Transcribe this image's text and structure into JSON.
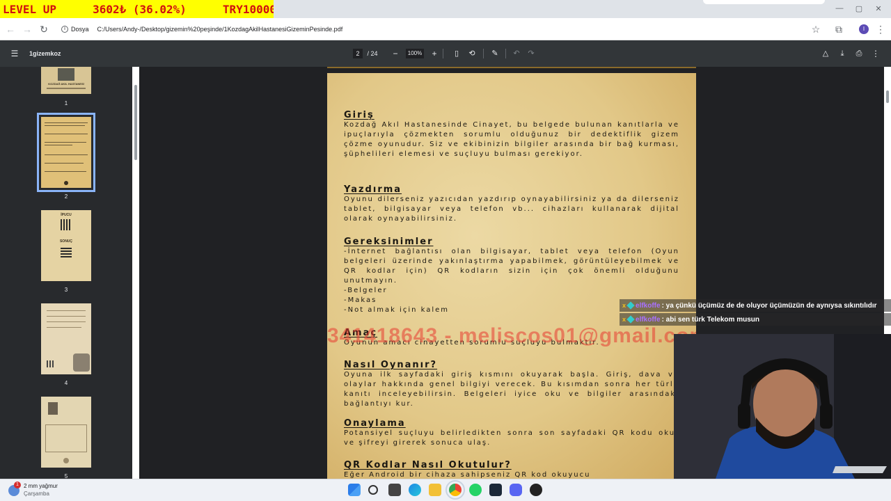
{
  "alert": {
    "level": "LEVEL UP",
    "amount": "3602₺ (36.02%)",
    "target": "TRY10000"
  },
  "browser": {
    "site_label": "Dosya",
    "url": "C:/Users/Andy-/Desktop/gizemin%20peşinde/1KozdagAkilHastanesiGizeminPesinde.pdf"
  },
  "pdf_toolbar": {
    "doc_title": "1gizemkoz",
    "current_page": "2",
    "total_pages": "/ 24",
    "zoom": "100%"
  },
  "sidebar": {
    "pages": [
      {
        "num": "1",
        "label": "KOZDAĞ AKIL HASTANESİ"
      },
      {
        "num": "2"
      },
      {
        "num": "3",
        "top": "İPUCU",
        "bottom": "SONUÇ"
      },
      {
        "num": "4"
      },
      {
        "num": "5"
      }
    ]
  },
  "document": {
    "sections": [
      {
        "heading": "Giriş",
        "body": "Kozdağ Akıl Hastanesinde Cinayet, bu belgede bulunan kanıtlarla ve ipuçlarıyla çözmekten sorumlu olduğunuz bir dedektiflik gizem çözme oyunudur. Siz ve ekibinizin bilgiler arasında bir bağ kurması, şüphelileri elemesi ve suçluyu bulması gerekiyor."
      },
      {
        "heading": "Yazdırma",
        "body": "Oyunu dilerseniz yazıcıdan yazdırıp oynayabilirsiniz ya da dilerseniz tablet, bilgisayar veya telefon vb... cihazları kullanarak dijital olarak oynayabilirsiniz."
      },
      {
        "heading": "Gereksinimler",
        "body": "-İnternet bağlantısı olan bilgisayar, tablet veya telefon (Oyun belgeleri üzerinde yakınlaştırma yapabilmek, görüntüleyebilmek ve QR kodlar için) QR kodların sizin için çok önemli olduğunu unutmayın.",
        "list": [
          "-Belgeler",
          "-Makas",
          "-Not almak için kalem"
        ]
      },
      {
        "heading": "Amaç",
        "body": "Oyunun amacı cinayetten sorumlu suçluyu bulmaktır."
      },
      {
        "heading": "Nasıl Oynanır?",
        "body": "Oyuna ilk sayfadaki giriş kısmını okuyarak başla. Giriş, dava ve olaylar hakkında genel bilgiyi verecek. Bu kısımdan sonra her türlü kanıtı inceleyebilirsin. Belgeleri iyice oku ve bilgiler arasındaki bağlantıyı kur."
      },
      {
        "heading": "Onaylama",
        "body": "Potansiyel suçluyu belirledikten sonra son sayfadaki QR kodu okut ve şifreyi girerek sonuca ulaş."
      },
      {
        "heading": "QR Kodlar Nasıl Okutulur?",
        "body": "Eğer Android bir cihaza sahipseniz QR kod okuyucu"
      }
    ],
    "watermark": "341418643 - meliscos01@gmail.com"
  },
  "chat": [
    {
      "user": "elfkoffe",
      "message": ": ya çünkü üçümüz de de oluyor üçümüzün de aynıysa sıkıntılıdır"
    },
    {
      "user": "elfkoffe",
      "message": ": abi sen türk Telekom musun"
    }
  ],
  "taskbar": {
    "weather_temp": "2 mm yağmur",
    "weather_day": "Çarşamba",
    "notif_count": "1"
  },
  "colors": {
    "accent": "#8ab4f8",
    "alert_bg": "#ffff00",
    "alert_text": "#d01010",
    "toolbar": "#323639"
  }
}
